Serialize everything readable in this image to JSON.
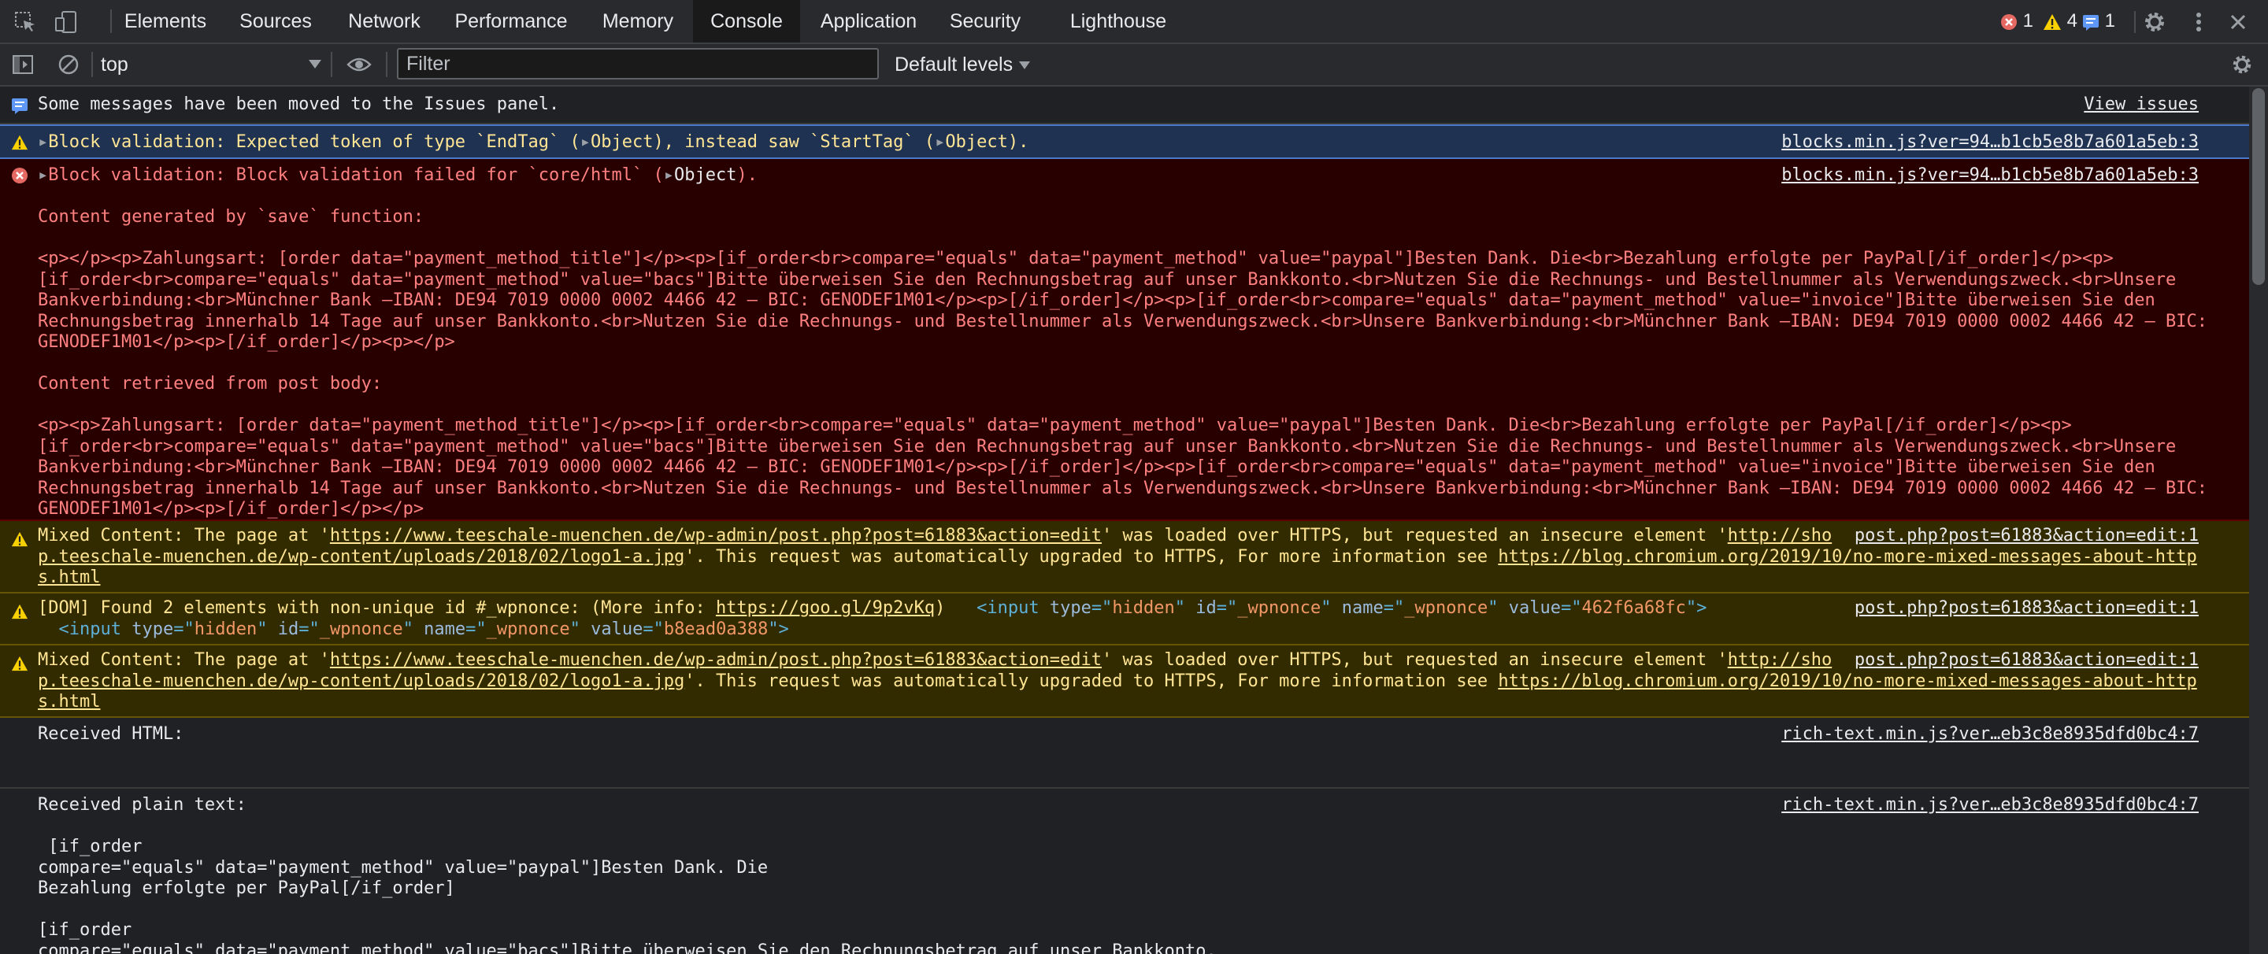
{
  "tabs": [
    "Elements",
    "Sources",
    "Network",
    "Performance",
    "Memory",
    "Console",
    "Application",
    "Security",
    "Lighthouse"
  ],
  "active_tab": "Console",
  "badges": {
    "errors": "1",
    "warnings": "4",
    "info": "1"
  },
  "toolbar": {
    "context": "top",
    "filter_placeholder": "Filter",
    "levels": "Default levels"
  },
  "icons": [
    "inspect-icon",
    "device-toggle-icon",
    "settings-gear-icon",
    "more-vertical-icon",
    "sidebar-toggle-icon",
    "clear-console-icon",
    "eye-icon",
    "console-settings-icon",
    "info-icon",
    "warning-icon",
    "error-icon"
  ],
  "colors": {
    "warning_text": "#ffe594",
    "error_text": "#ff8080",
    "warning_bg": "#332b00",
    "error_bg": "#290000",
    "link_blue": "#4c7acb"
  },
  "messages": {
    "m1": {
      "text": "Some messages have been moved to the Issues panel.",
      "link": "View issues"
    },
    "m2": {
      "pre": "Block validation: Expected token of type `EndTag` (",
      "obj": "Object",
      "mid": "), instead saw `StartTag` (",
      "obj2": "Object",
      "post": ").",
      "source": "blocks.min.js?ver=94…b1cb5e8b7a601a5eb:3"
    },
    "m3": {
      "pre": "Block validation: Block validation failed for `core/html` (",
      "obj": "Object",
      "post": ").",
      "source": "blocks.min.js?ver=94…b1cb5e8b7a601a5eb:3",
      "body": [
        "",
        "Content generated by `save` function:",
        "",
        "<p></p><p>Zahlungsart: [order data=\"payment_method_title\"]</p><p>[if_order<br>compare=\"equals\" data=\"payment_method\" value=\"paypal\"]Besten Dank. Die<br>Bezahlung erfolgte per PayPal[/if_order]</p><p>",
        "[if_order<br>compare=\"equals\" data=\"payment_method\" value=\"bacs\"]Bitte überweisen Sie den Rechnungsbetrag auf unser Bankkonto.<br>Nutzen Sie die Rechnungs- und Bestellnummer als Verwendungszweck.<br>Unsere",
        "Bankverbindung:<br>Münchner Bank –IBAN: DE94 7019 0000 0002 4466 42 – BIC: GENODEF1M01</p><p>[/if_order]</p><p>[if_order<br>compare=\"equals\" data=\"payment_method\" value=\"invoice\"]Bitte überweisen Sie den",
        "Rechnungsbetrag innerhalb 14 Tage auf unser Bankkonto.<br>Nutzen Sie die Rechnungs- und Bestellnummer als Verwendungszweck.<br>Unsere Bankverbindung:<br>Münchner Bank –IBAN: DE94 7019 0000 0002 4466 42 – BIC:",
        "GENODEF1M01</p><p>[/if_order]</p><p></p>",
        "",
        "Content retrieved from post body:",
        "",
        "<p><p>Zahlungsart: [order data=\"payment_method_title\"]</p><p>[if_order<br>compare=\"equals\" data=\"payment_method\" value=\"paypal\"]Besten Dank. Die<br>Bezahlung erfolgte per PayPal[/if_order]</p><p>",
        "[if_order<br>compare=\"equals\" data=\"payment_method\" value=\"bacs\"]Bitte überweisen Sie den Rechnungsbetrag auf unser Bankkonto.<br>Nutzen Sie die Rechnungs- und Bestellnummer als Verwendungszweck.<br>Unsere",
        "Bankverbindung:<br>Münchner Bank –IBAN: DE94 7019 0000 0002 4466 42 – BIC: GENODEF1M01</p><p>[/if_order]</p><p>[if_order<br>compare=\"equals\" data=\"payment_method\" value=\"invoice\"]Bitte überweisen Sie den",
        "Rechnungsbetrag innerhalb 14 Tage auf unser Bankkonto.<br>Nutzen Sie die Rechnungs- und Bestellnummer als Verwendungszweck.<br>Unsere Bankverbindung:<br>Münchner Bank –IBAN: DE94 7019 0000 0002 4466 42 – BIC:",
        "GENODEF1M01</p><p>[/if_order]</p></p>"
      ]
    },
    "m4": {
      "a": "Mixed Content: The page at '",
      "link1": "https://www.teeschale-muenchen.de/wp-admin/post.php?post=61883&action=edit",
      "b": "' was loaded over HTTPS, but requested an insecure element '",
      "link2a": "http://sho",
      "link2b": "p.teeschale-muenchen.de/wp-content/uploads/2018/02/logo1-a.jpg",
      "c": "'. This request was automatically upgraded to HTTPS, For more information see ",
      "link3a": "https://blog.chromium.org/2019/10/no-more-mixed-messages-about-http",
      "link3b": "s.html",
      "source": "post.php?post=61883&action=edit:1"
    },
    "m5": {
      "a": "[DOM] Found 2 elements with non-unique id #_wpnonce: (More info: ",
      "link": "https://goo.gl/9p2vKq",
      "b": ")",
      "el1": {
        "tag": "input",
        "type_attr": "type",
        "type_val": "hidden",
        "id_attr": "id",
        "id_val": "_wpnonce",
        "name_attr": "name",
        "name_val": "_wpnonce",
        "value_attr": "value",
        "value_val": "462f6a68fc"
      },
      "el2": {
        "tag": "input",
        "type_attr": "type",
        "type_val": "hidden",
        "id_attr": "id",
        "id_val": "_wpnonce",
        "name_attr": "name",
        "name_val": "_wpnonce",
        "value_attr": "value",
        "value_val": "b8ead0a388"
      },
      "source": "post.php?post=61883&action=edit:1"
    },
    "m6": {
      "a": "Mixed Content: The page at '",
      "link1": "https://www.teeschale-muenchen.de/wp-admin/post.php?post=61883&action=edit",
      "b": "' was loaded over HTTPS, but requested an insecure element '",
      "link2a": "http://sho",
      "link2b": "p.teeschale-muenchen.de/wp-content/uploads/2018/02/logo1-a.jpg",
      "c": "'. This request was automatically upgraded to HTTPS, For more information see ",
      "link3a": "https://blog.chromium.org/2019/10/no-more-mixed-messages-about-http",
      "link3b": "s.html",
      "source": "post.php?post=61883&action=edit:1"
    },
    "m7": {
      "text": "Received HTML:",
      "source": "rich-text.min.js?ver…eb3c8e8935dfd0bc4:7"
    },
    "m8": {
      "text": "Received plain text:",
      "source": "rich-text.min.js?ver…eb3c8e8935dfd0bc4:7",
      "body": [
        "",
        " [if_order",
        "compare=\"equals\" data=\"payment_method\" value=\"paypal\"]Besten Dank. Die",
        "Bezahlung erfolgte per PayPal[/if_order]",
        "",
        "[if_order",
        "compare=\"equals\" data=\"payment_method\" value=\"bacs\"]Bitte überweisen Sie den Rechnungsbetrag auf unser Bankkonto."
      ]
    }
  }
}
